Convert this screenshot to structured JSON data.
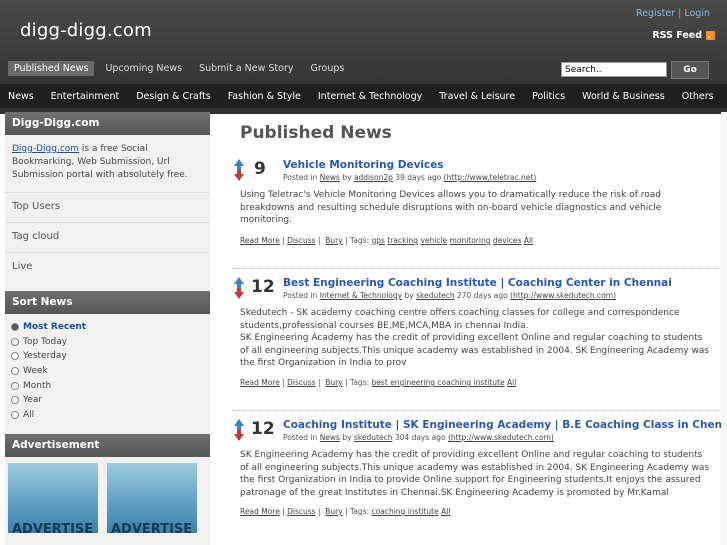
{
  "header": {
    "logo": "digg-digg.com",
    "register": "Register",
    "separator": "|",
    "login": "Login",
    "rss": "RSS Feed",
    "rss_icon": "rss-icon"
  },
  "subnav": [
    "Published News",
    "Upcoming News",
    "Submit a New Story",
    "Groups"
  ],
  "search": {
    "value": "Search..",
    "button": "Go"
  },
  "categories": [
    "News",
    "Entertainment",
    "Design & Crafts",
    "Fashion & Style",
    "Internet & Technology",
    "Travel & Leisure",
    "Politics",
    "World & Business",
    "Others"
  ],
  "sidebar": {
    "site_title": "Digg-Digg.com",
    "intro_link": "Digg-Digg.com",
    "intro_text": " is a free Social Bookmarking, Web Submission, Url Submission portal with absolutely free.",
    "links": [
      "Top Users",
      "Tag cloud",
      "Live"
    ],
    "sort_title": "Sort News",
    "sort_options": [
      "Most Recent",
      "Top Today",
      "Yesterday",
      "Week",
      "Month",
      "Year",
      "All"
    ],
    "ad_title": "Advertisement",
    "ad_text": "ADVERTISE"
  },
  "main": {
    "title": "Published News",
    "stories": [
      {
        "votes": "9",
        "title": "Vehicle Monitoring Devices",
        "meta_prefix": "Posted in ",
        "category": "News",
        "by": " by ",
        "user": "addison2p",
        "age": " 39 days ago ",
        "url": "(http://www.teletrac.net)",
        "body": "Using Teletrac's Vehicle Monitoring Devices allows you to dramatically reduce the risk of road breakdowns and resulting schedule disruptions with on-board vehicle diagnostics and vehicle monitoring.",
        "read_more": "Read More",
        "discuss": "Discuss",
        "bury": "Bury",
        "tags_label": "Tags:",
        "tags": [
          "gps",
          "tracking",
          "vehicle",
          "monitoring",
          "devices",
          "All"
        ]
      },
      {
        "votes": "12",
        "title": "Best Engineering Coaching Institute | Coaching Center in Chennai",
        "meta_prefix": "Posted in ",
        "category": "Internet & Technology",
        "by": " by ",
        "user": "skedutech",
        "age": " 270 days ago ",
        "url": "(http://www.skedutech.com)",
        "body": "Skedutech - SK academy coaching centre offers coaching classes for college and correspondence students,professional courses BE,ME,MCA,MBA in chennai India.\nSK Engineering Academy has the credit of providing excellent Online and regular coaching to students of all engineering subjects.This unique academy was established in 2004. SK Engineering Academy was the first Organization in India to prov",
        "read_more": "Read More",
        "discuss": "Discuss",
        "bury": "Bury",
        "tags_label": "Tags:",
        "tags": [
          "best engineering coaching institute",
          "All"
        ]
      },
      {
        "votes": "12",
        "title": "Coaching Institute | SK Engineering Academy | B.E Coaching Class in Chennai",
        "meta_prefix": "Posted in ",
        "category": "News",
        "by": " by ",
        "user": "skedutech",
        "age": " 304 days ago ",
        "url": "(http://www.skedutech.com)",
        "body": "SK Engineering Academy has the credit of providing excellent Online and regular coaching to students of all engineering subjects.This unique academy was established in 2004. SK Engineering Academy was the first Organization in India to provide Online support for Engineering students.It enjoys the assured patronage of the great Institutes in Chennai.SK Engineering Academy is promoted by Mr.Kamal",
        "read_more": "Read More",
        "discuss": "Discuss",
        "bury": "Bury",
        "tags_label": "Tags:",
        "tags": [
          "coaching institute",
          "All"
        ]
      }
    ]
  }
}
